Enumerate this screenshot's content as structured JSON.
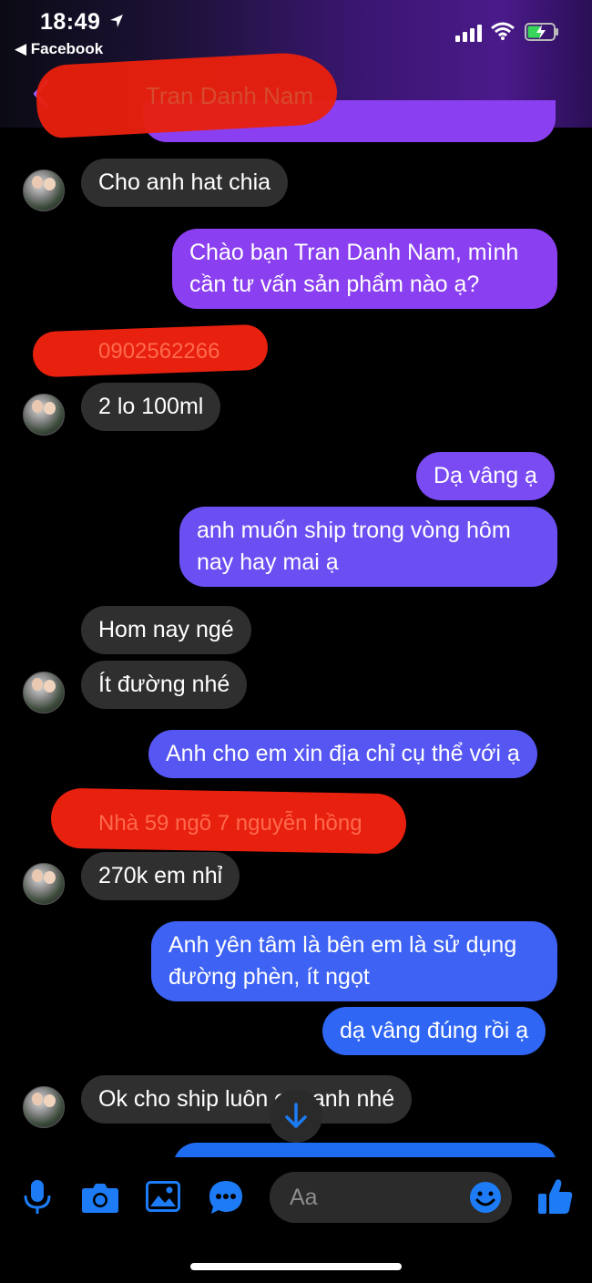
{
  "status_bar": {
    "time": "18:49",
    "back_app": "◀ Facebook"
  },
  "header": {
    "contact_name": "Tran Danh Nam"
  },
  "messages": [
    {
      "text": "Cho anh hat chia"
    },
    {
      "text": "Chào bạn Tran Danh Nam, mình cần tư vấn sản phẩm nào ạ?"
    },
    {
      "text": "0902562266"
    },
    {
      "text": "2 lo 100ml"
    },
    {
      "text": "Dạ vâng ạ"
    },
    {
      "text": "anh muốn ship trong vòng hôm nay hay mai ạ"
    },
    {
      "text": "Hom nay ngé"
    },
    {
      "text": "Ít đường nhé"
    },
    {
      "text": "Anh cho em xin địa chỉ cụ thể với ạ"
    },
    {
      "text": "Nhà 59 ngõ 7 nguyễn hồng"
    },
    {
      "text": "270k em nhỉ"
    },
    {
      "text": "Anh yên tâm là bên em là sử dụng đường phèn, ít ngọt"
    },
    {
      "text": "dạ vâng đúng rồi ạ"
    },
    {
      "text": "Ok cho ship luôn em anh nhé"
    }
  ],
  "composer": {
    "placeholder": "Aa"
  },
  "colors": {
    "incoming_bubble": "#2f2f2f",
    "outgoing_top": "#8a3ff0",
    "outgoing_bottom": "#1e6cf2",
    "accent": "#1d7cf5",
    "redaction": "#e8200e"
  },
  "icons": [
    "microphone-icon",
    "camera-icon",
    "image-icon",
    "sticker-icon",
    "emoji-icon",
    "like-icon",
    "arrow-down-icon",
    "back-chevron-icon"
  ]
}
